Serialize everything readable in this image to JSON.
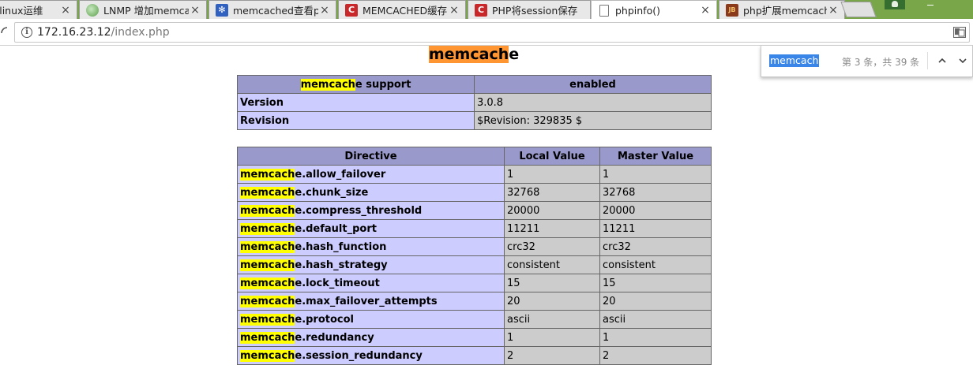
{
  "tabs": [
    {
      "title": "– linux运维",
      "favicon": "none",
      "active": false
    },
    {
      "title": "LNMP 增加memca",
      "favicon": "globe-icon",
      "active": false
    },
    {
      "title": "memcached查看p",
      "favicon": "paw-icon",
      "active": false
    },
    {
      "title": "MEMCACHED缓存",
      "favicon": "csdn-icon",
      "active": false
    },
    {
      "title": "PHP将session保存",
      "favicon": "csdn-icon",
      "active": false
    },
    {
      "title": "phpinfo()",
      "favicon": "document-icon",
      "active": true
    },
    {
      "title": "php扩展memcach",
      "favicon": "jb-icon",
      "active": false
    }
  ],
  "tab_close_glyph": "×",
  "favicon_letters": {
    "csdn": "C",
    "jb": "JB",
    "paw": "✻"
  },
  "address": {
    "host": "172.16.23.12",
    "path": "/index.php"
  },
  "find": {
    "query": "memcach",
    "count": "第 3 条，共 39 条",
    "prev_glyph": "︿",
    "next_glyph": "﹀"
  },
  "page": {
    "heading": {
      "highlight": "memcach",
      "rest": "e"
    },
    "support_table": {
      "headers": [
        {
          "highlight": "memcach",
          "rest": "e support"
        },
        {
          "text": "enabled"
        }
      ],
      "rows": [
        {
          "name": "Version",
          "value": "3.0.8"
        },
        {
          "name": "Revision",
          "value": "$Revision: 329835 $"
        }
      ]
    },
    "directive_table": {
      "headers": [
        "Directive",
        "Local Value",
        "Master Value"
      ],
      "prefix_highlight": "memcach",
      "prefix_rest": "e",
      "rows": [
        {
          "suffix": ".allow_failover",
          "local": "1",
          "master": "1"
        },
        {
          "suffix": ".chunk_size",
          "local": "32768",
          "master": "32768"
        },
        {
          "suffix": ".compress_threshold",
          "local": "20000",
          "master": "20000"
        },
        {
          "suffix": ".default_port",
          "local": "11211",
          "master": "11211"
        },
        {
          "suffix": ".hash_function",
          "local": "crc32",
          "master": "crc32"
        },
        {
          "suffix": ".hash_strategy",
          "local": "consistent",
          "master": "consistent"
        },
        {
          "suffix": ".lock_timeout",
          "local": "15",
          "master": "15"
        },
        {
          "suffix": ".max_failover_attempts",
          "local": "20",
          "master": "20"
        },
        {
          "suffix": ".protocol",
          "local": "ascii",
          "master": "ascii"
        },
        {
          "suffix": ".redundancy",
          "local": "1",
          "master": "1"
        },
        {
          "suffix": ".session_redundancy",
          "local": "2",
          "master": "2"
        }
      ]
    }
  },
  "colors": {
    "header_bg": "#9999cc",
    "name_bg": "#ccccff",
    "value_bg": "#cccccc",
    "find_current": "#ff9632",
    "find_match": "#ffff00",
    "tabstrip_bg": "#7aa64a"
  }
}
